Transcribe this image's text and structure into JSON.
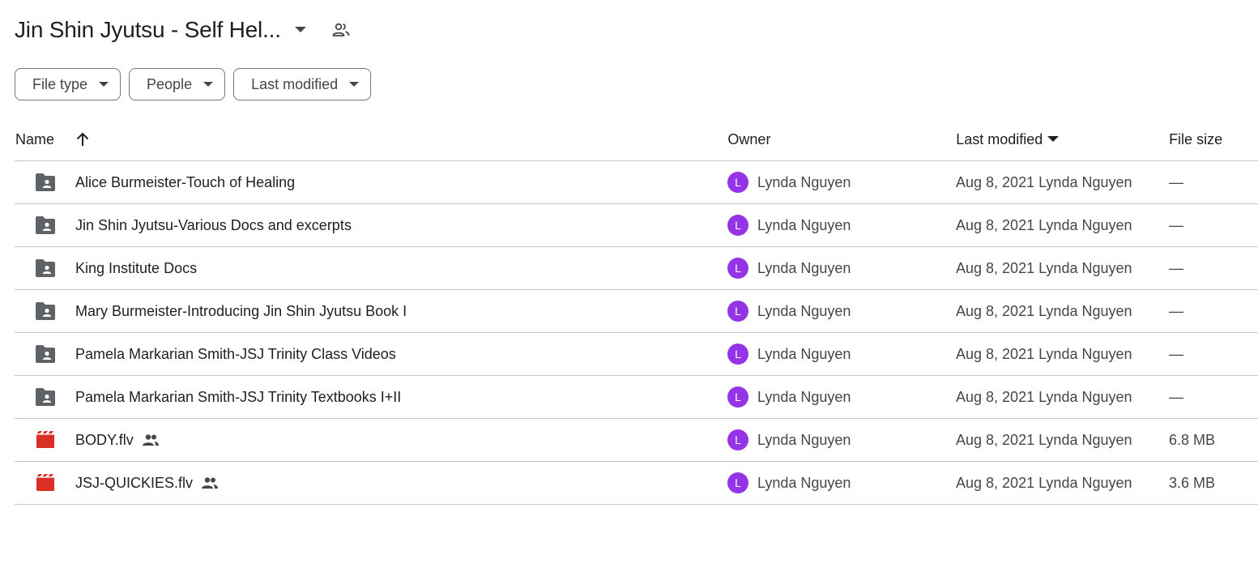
{
  "header": {
    "title": "Jin Shin Jyutsu - Self Hel...",
    "dropdown_icon": "caret-down-icon",
    "shared_icon": "people-outline-icon"
  },
  "filters": [
    {
      "label": "File type"
    },
    {
      "label": "People"
    },
    {
      "label": "Last modified"
    }
  ],
  "columns": {
    "name": "Name",
    "owner": "Owner",
    "last_modified": "Last modified",
    "file_size": "File size"
  },
  "colors": {
    "avatar": "#9334e6",
    "folder_icon": "#5f6368",
    "video_icon": "#d93025"
  },
  "rows": [
    {
      "type": "folder",
      "name": "Alice Burmeister-Touch of Healing",
      "shared": false,
      "owner_initial": "L",
      "owner": "Lynda Nguyen",
      "modified": "Aug 8, 2021 Lynda Nguyen",
      "size": "—"
    },
    {
      "type": "folder",
      "name": "Jin Shin Jyutsu-Various Docs and excerpts",
      "shared": false,
      "owner_initial": "L",
      "owner": "Lynda Nguyen",
      "modified": "Aug 8, 2021 Lynda Nguyen",
      "size": "—"
    },
    {
      "type": "folder",
      "name": "King Institute Docs",
      "shared": false,
      "owner_initial": "L",
      "owner": "Lynda Nguyen",
      "modified": "Aug 8, 2021 Lynda Nguyen",
      "size": "—"
    },
    {
      "type": "folder",
      "name": "Mary Burmeister-Introducing Jin Shin Jyutsu Book I",
      "shared": false,
      "owner_initial": "L",
      "owner": "Lynda Nguyen",
      "modified": "Aug 8, 2021 Lynda Nguyen",
      "size": "—"
    },
    {
      "type": "folder",
      "name": "Pamela Markarian Smith-JSJ Trinity Class Videos",
      "shared": false,
      "owner_initial": "L",
      "owner": "Lynda Nguyen",
      "modified": "Aug 8, 2021 Lynda Nguyen",
      "size": "—"
    },
    {
      "type": "folder",
      "name": "Pamela Markarian Smith-JSJ Trinity Textbooks I+II",
      "shared": false,
      "owner_initial": "L",
      "owner": "Lynda Nguyen",
      "modified": "Aug 8, 2021 Lynda Nguyen",
      "size": "—"
    },
    {
      "type": "video",
      "name": "BODY.flv",
      "shared": true,
      "owner_initial": "L",
      "owner": "Lynda Nguyen",
      "modified": "Aug 8, 2021 Lynda Nguyen",
      "size": "6.8 MB"
    },
    {
      "type": "video",
      "name": "JSJ-QUICKIES.flv",
      "shared": true,
      "owner_initial": "L",
      "owner": "Lynda Nguyen",
      "modified": "Aug 8, 2021 Lynda Nguyen",
      "size": "3.6 MB"
    }
  ]
}
